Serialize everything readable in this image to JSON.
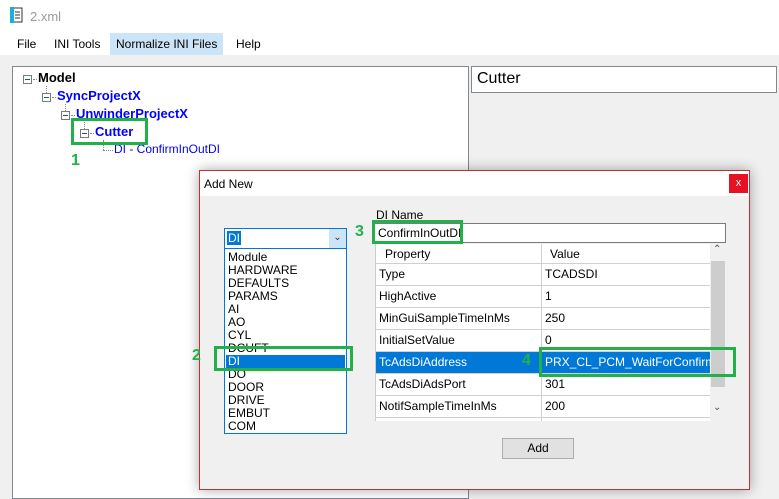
{
  "window": {
    "title": "2.xml",
    "icon": "document-icon"
  },
  "menu": [
    "File",
    "INI Tools",
    "Normalize INI Files",
    "Help"
  ],
  "tree": {
    "root": "Model",
    "level1": "SyncProjectX",
    "level2": "UnwinderProjectX",
    "level3": "Cutter",
    "leaf": "DI - ConfirmInOutDI"
  },
  "right_panel": {
    "name": "Cutter"
  },
  "annotations": [
    "1",
    "2",
    "3",
    "4"
  ],
  "annotation_color": "#22b04b",
  "dialog": {
    "title": "Add New",
    "close": "x",
    "combo_value": "DI",
    "list": [
      "Module",
      "HARDWARE",
      "DEFAULTS",
      "PARAMS",
      "AI",
      "AO",
      "CYL",
      "DCUFT",
      "DI",
      "DO",
      "DOOR",
      "DRIVE",
      "EMBUT",
      "COM"
    ],
    "selected_item": "DI",
    "di_name_label": "DI Name",
    "di_name_value": "ConfirmInOutDI",
    "grid": {
      "headers": [
        "Property",
        "Value"
      ],
      "rows": [
        [
          "Type",
          "TCADSDI"
        ],
        [
          "HighActive",
          "1"
        ],
        [
          "MinGuiSampleTimeInMs",
          "250"
        ],
        [
          "InitialSetValue",
          "0"
        ],
        [
          "TcAdsDiAddress",
          "PRX_CL_PCM_WaitForConfirm..."
        ],
        [
          "TcAdsDiAdsPort",
          "301"
        ],
        [
          "NotifSampleTimeInMs",
          "200"
        ]
      ],
      "selected_row": "TcAdsDiAddress"
    },
    "add_button": "Add"
  }
}
